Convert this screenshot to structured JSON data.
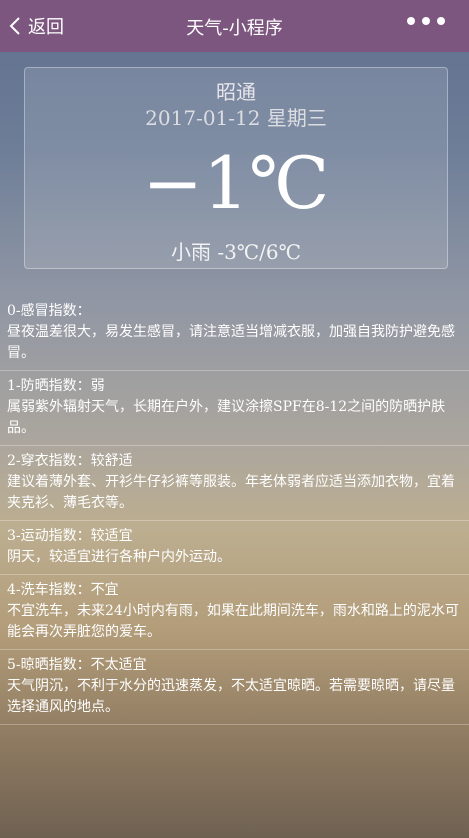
{
  "navbar": {
    "back_label": "返回",
    "title": "天气-小程序"
  },
  "weather": {
    "city": "昭通",
    "date": "2017-01-12",
    "weekday": "星期三",
    "temperature": "−1℃",
    "condition": "小雨 -3℃/6℃"
  },
  "indices": [
    {
      "title": "0-感冒指数：",
      "desc": "昼夜温差很大，易发生感冒，请注意适当增减衣服，加强自我防护避免感冒。"
    },
    {
      "title": "1-防晒指数：弱",
      "desc": "属弱紫外辐射天气，长期在户外，建议涂擦SPF在8-12之间的防晒护肤品。"
    },
    {
      "title": "2-穿衣指数：较舒适",
      "desc": "建议着薄外套、开衫牛仔衫裤等服装。年老体弱者应适当添加衣物，宜着夹克衫、薄毛衣等。"
    },
    {
      "title": "3-运动指数：较适宜",
      "desc": "阴天，较适宜进行各种户内外运动。"
    },
    {
      "title": "4-洗车指数：不宜",
      "desc": "不宜洗车，未来24小时内有雨，如果在此期间洗车，雨水和路上的泥水可能会再次弄脏您的爱车。"
    },
    {
      "title": "5-晾晒指数：不太适宜",
      "desc": "天气阴沉，不利于水分的迅速蒸发，不太适宜晾晒。若需要晾晒，请尽量选择通风的地点。"
    }
  ]
}
